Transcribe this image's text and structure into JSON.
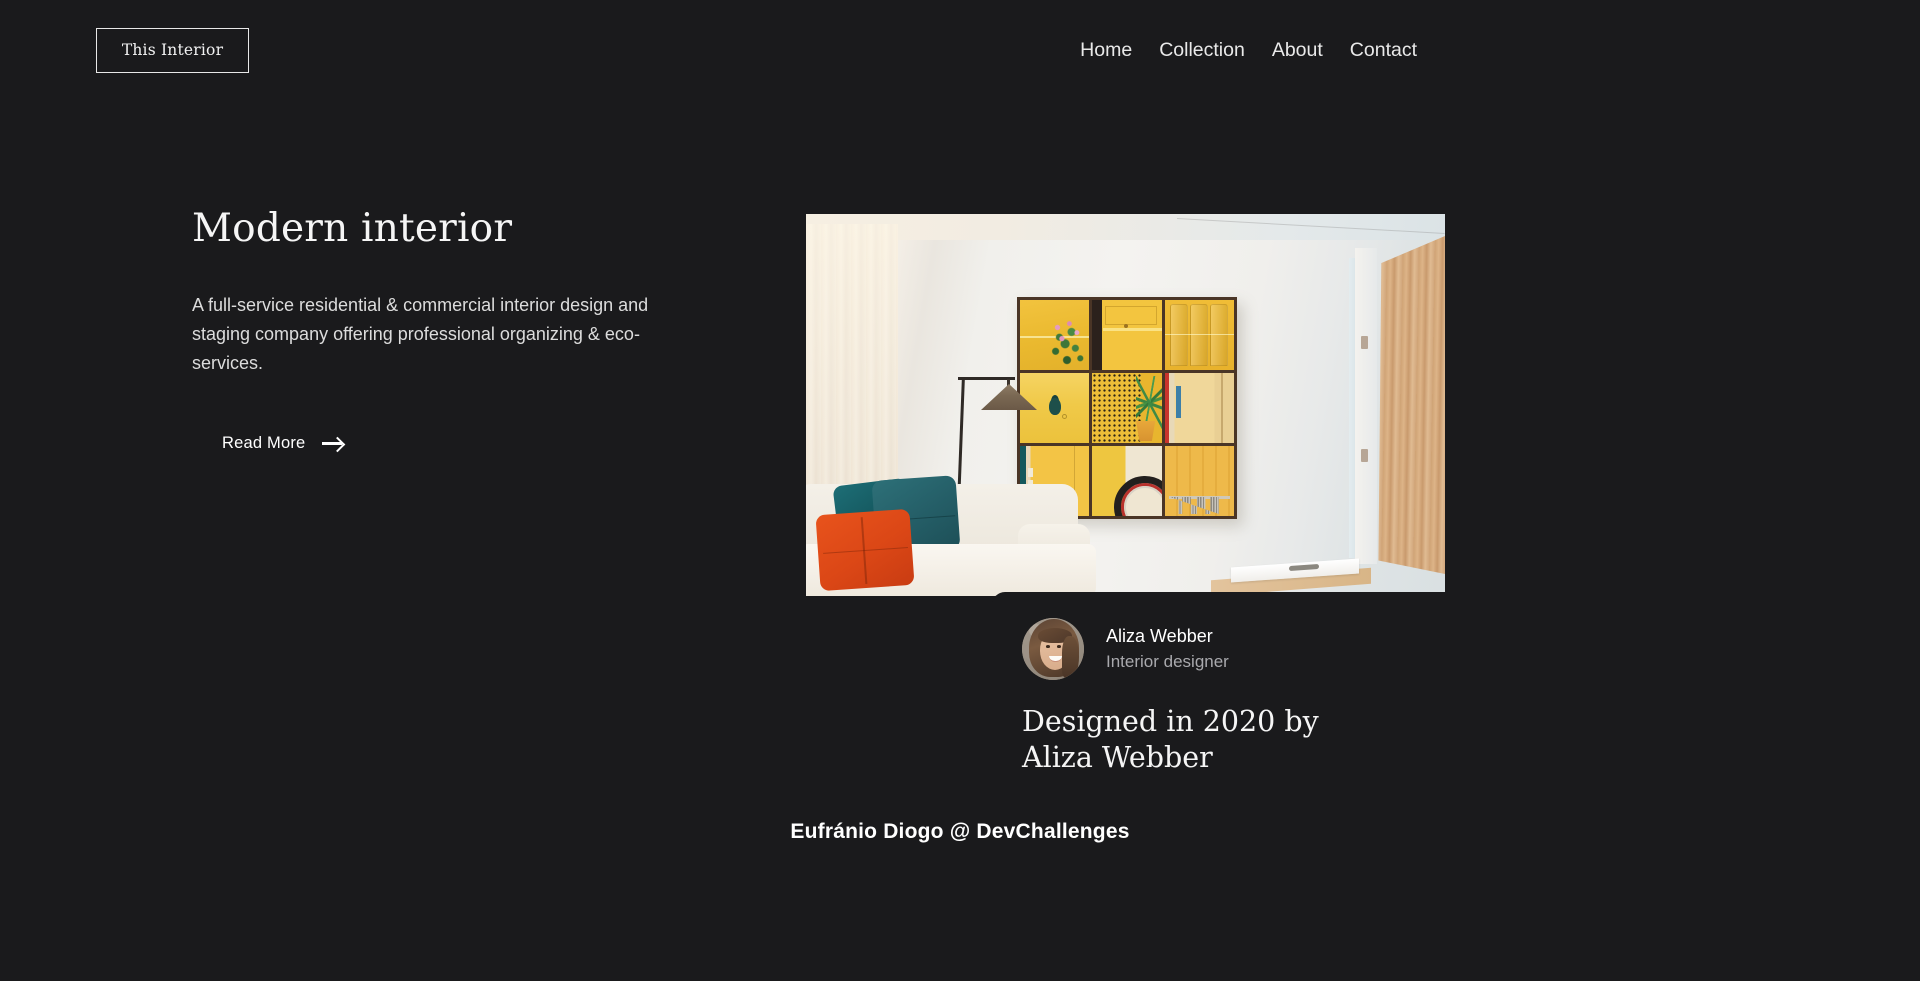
{
  "brand": {
    "name": "This Interior"
  },
  "nav": {
    "items": [
      {
        "label": "Home"
      },
      {
        "label": "Collection"
      },
      {
        "label": "About"
      },
      {
        "label": "Contact"
      }
    ]
  },
  "hero": {
    "title": "Modern interior",
    "description": "A full-service residential & commercial interior design and staging company offering professional organizing & eco-services.",
    "cta_label": "Read More",
    "cta_icon": "arrow-right-icon"
  },
  "showcase": {
    "photo_alt": "Modern living room with yellow gridded wall art, floor lamp, white sofa with teal and orange cushions"
  },
  "designer": {
    "name": "Aliza Webber",
    "role": "Interior designer",
    "caption": "Designed in 2020 by\nAliza Webber",
    "avatar_alt": "Portrait of Aliza Webber"
  },
  "footer": {
    "credit": "Eufránio Diogo @ DevChallenges"
  },
  "theme": {
    "background": "#1a1a1c",
    "text": "#ffffff",
    "muted": "#a9a9ad"
  }
}
